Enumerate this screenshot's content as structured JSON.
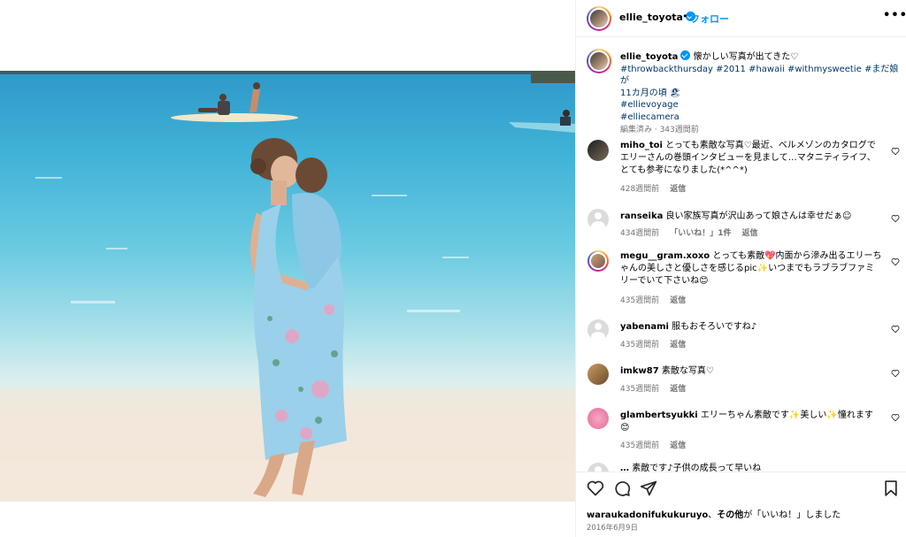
{
  "post": {
    "username": "ellie_toyota",
    "follow_label": "フォロー",
    "separator": "•",
    "caption": {
      "text": "懐かしい写真が出てきた♡",
      "hashtags_line1": "#throwbackthursday #2011 #hawaii #withmysweetie",
      "line1_tail": " #まだ娘が",
      "line2": "11カ月の頃 🏖",
      "tag_voyage": "#ellievoyage",
      "tag_camera": "#elliecamera",
      "meta": "編集済み · 343週間前"
    },
    "likes_by": "waraukadonifukukuruyo",
    "likes_tail_bold": "その他",
    "likes_tail_rest": "が「いいね！」しました",
    "date": "2016年6月9日"
  },
  "comments": [
    {
      "username": "miho_toi",
      "text": "とっても素敵な写真♡最近、ベルメゾンのカタログでエリーさんの巻頭インタビューを見まして…マタニティライフ、とても参考になりました(*^^*)",
      "time": "428週間前",
      "reply": "返信",
      "likes": ""
    },
    {
      "username": "ranseika",
      "text": "良い家族写真が沢山あって娘さんは幸せだぁ☺",
      "time": "434週間前",
      "reply": "返信",
      "likes": "「いいね！」1件"
    },
    {
      "username": "megu__gram.xoxo",
      "text": "とっても素敵💖内面から滲み出るエリーちゃんの美しさと優しさを感じるpic✨いつまでもラブラブファミリーでいて下さいね😊",
      "time": "435週間前",
      "reply": "返信",
      "likes": ""
    },
    {
      "username": "yabenami",
      "text": "服もおそろいですね♪",
      "time": "435週間前",
      "reply": "返信",
      "likes": ""
    },
    {
      "username": "imkw87",
      "text": "素敵な写真♡",
      "time": "435週間前",
      "reply": "返信",
      "likes": ""
    },
    {
      "username": "glambertsyukki",
      "text": "エリーちゃん素敵です✨美しい✨憧れます😊",
      "time": "435週間前",
      "reply": "返信",
      "likes": ""
    },
    {
      "username": "…",
      "text": "素敵です♪子供の成長って早いね",
      "time": "",
      "reply": "",
      "likes": ""
    }
  ],
  "icons": {
    "verified": "verified-badge-icon",
    "more": "more-options-icon",
    "like": "heart-icon",
    "comment": "comment-icon",
    "share": "share-icon",
    "save": "bookmark-icon"
  },
  "colors": {
    "accent": "#0095f6",
    "hashtag": "#00376b",
    "muted": "#737373"
  }
}
